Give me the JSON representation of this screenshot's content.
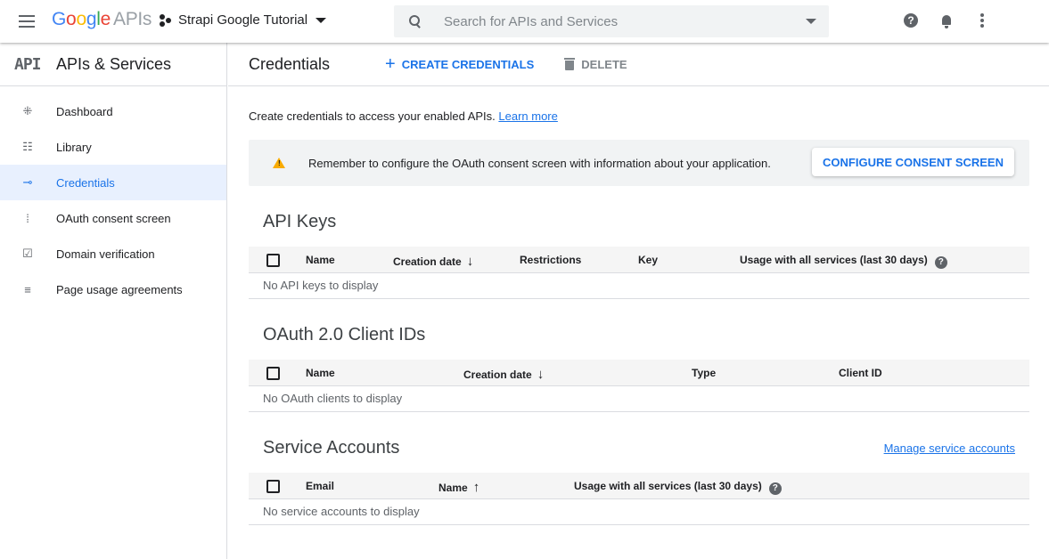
{
  "topbar": {
    "logo": {
      "g1": "G",
      "o1": "o",
      "o2": "o",
      "g2": "g",
      "l": "l",
      "e": "e",
      "apis": "APIs"
    },
    "project_name": "Strapi Google Tutorial",
    "search_placeholder": "Search for APIs and Services",
    "help_glyph": "?"
  },
  "sidebar": {
    "logo_text": "API",
    "title": "APIs & Services",
    "items": [
      {
        "label": "Dashboard",
        "icon": "dashboard-icon",
        "glyph": "⁜"
      },
      {
        "label": "Library",
        "icon": "library-icon",
        "glyph": "☷"
      },
      {
        "label": "Credentials",
        "icon": "key-icon",
        "glyph": "⊸",
        "active": true
      },
      {
        "label": "OAuth consent screen",
        "icon": "consent-icon",
        "glyph": "⁞"
      },
      {
        "label": "Domain verification",
        "icon": "verification-icon",
        "glyph": "☑"
      },
      {
        "label": "Page usage agreements",
        "icon": "agreements-icon",
        "glyph": "≡"
      }
    ]
  },
  "main": {
    "title": "Credentials",
    "create_label": "CREATE CREDENTIALS",
    "create_glyph": "+",
    "delete_label": "DELETE",
    "intro_text": "Create credentials to access your enabled APIs.",
    "learn_more": "Learn more",
    "banner": {
      "text": "Remember to configure the OAuth consent screen with information about your application.",
      "button": "CONFIGURE CONSENT SCREEN",
      "warn_glyph": "!"
    },
    "api_keys": {
      "title": "API Keys",
      "columns": [
        "Name",
        "Creation date",
        "Restrictions",
        "Key",
        "Usage with all services (last 30 days)"
      ],
      "sort_glyph": "↓",
      "empty": "No API keys to display"
    },
    "oauth": {
      "title": "OAuth 2.0 Client IDs",
      "columns": [
        "Name",
        "Creation date",
        "Type",
        "Client ID"
      ],
      "sort_glyph": "↓",
      "empty": "No OAuth clients to display"
    },
    "service_accounts": {
      "title": "Service Accounts",
      "manage_link": "Manage service accounts",
      "columns": [
        "Email",
        "Name",
        "Usage with all services (last 30 days)"
      ],
      "sort_glyph": "↑",
      "empty": "No service accounts to display"
    }
  },
  "colors": {
    "accent": "#1a73e8",
    "active_bg": "#e8f0fe",
    "warning": "#f9ab00"
  }
}
